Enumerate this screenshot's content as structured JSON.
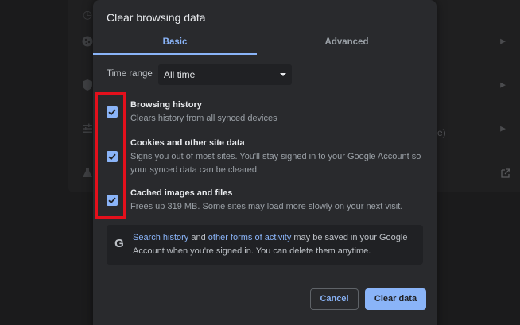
{
  "dialog": {
    "title": "Clear browsing data",
    "tabs": [
      {
        "label": "Basic",
        "selected": true
      },
      {
        "label": "Advanced",
        "selected": false
      }
    ]
  },
  "time_range": {
    "label": "Time range",
    "value": "All time"
  },
  "options": [
    {
      "title": "Browsing history",
      "description": "Clears history from all synced devices",
      "checked": true
    },
    {
      "title": "Cookies and other site data",
      "description": "Signs you out of most sites. You'll stay signed in to your Google Account so your synced data can be cleared.",
      "checked": true
    },
    {
      "title": "Cached images and files",
      "description": "Frees up 319 MB. Some sites may load more slowly on your next visit.",
      "checked": true
    }
  ],
  "sync_notice": {
    "icon": "google-g-icon",
    "link1": "Search history",
    "text1": " and ",
    "link2": "other forms of activity",
    "text2": " may be saved in your Google Account when you're signed in. You can delete them anytime."
  },
  "buttons": {
    "cancel": "Cancel",
    "clear": "Clear data"
  },
  "background": {
    "partial_text": "re)"
  },
  "colors": {
    "accent": "#8ab4f8",
    "dialog_bg": "#292a2d",
    "highlight": "#e3101c"
  }
}
